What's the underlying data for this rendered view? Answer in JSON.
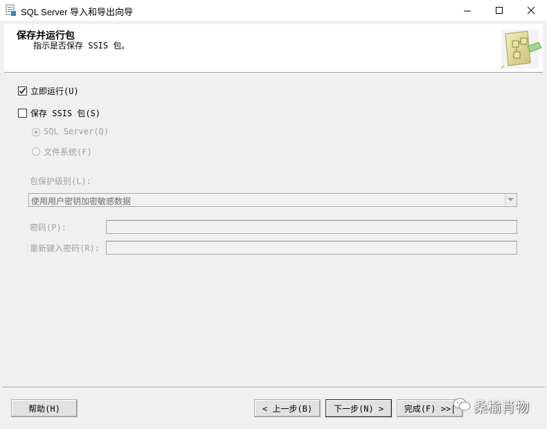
{
  "window": {
    "title": "SQL Server 导入和导出向导"
  },
  "header": {
    "title": "保存并运行包",
    "subtitle": "指示是否保存 SSIS 包。",
    "icon": "package-icon"
  },
  "options": {
    "run_immediately": {
      "label": "立即运行(U)",
      "checked": true
    },
    "save_ssis": {
      "label": "保存 SSIS 包(S)",
      "checked": false
    },
    "sql_server": {
      "label": "SQL Server(Q)",
      "selected": true,
      "enabled": false
    },
    "file_system": {
      "label": "文件系统(F)",
      "selected": false,
      "enabled": false
    }
  },
  "protection": {
    "label": "包保护级别(L):",
    "selected": "使用用户密钥加密敏感数据"
  },
  "password": {
    "label": "密码(P):",
    "value": ""
  },
  "reenter_password": {
    "label": "重新键入密码(R):",
    "value": ""
  },
  "buttons": {
    "help": "帮助(H)",
    "back": "< 上一步(B)",
    "next": "下一步(N) >",
    "finish": "完成(F) >>|"
  },
  "watermark": {
    "text": "桑榆肖物"
  }
}
